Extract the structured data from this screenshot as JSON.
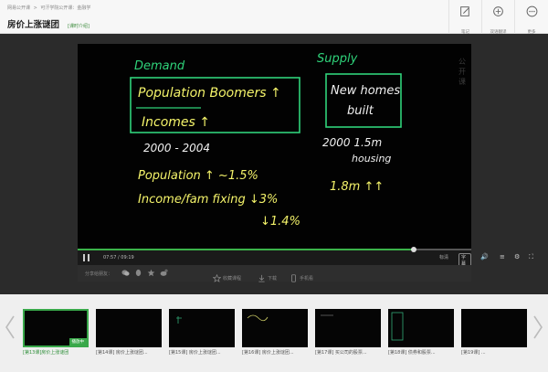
{
  "header": {
    "breadcrumb": [
      "网易公开课",
      ">",
      "可汗学院公开课：金融学"
    ],
    "title": "房价上涨谜团",
    "tag": "[课时介绍]",
    "buttons": [
      {
        "label": "笔记",
        "icon": "edit-icon"
      },
      {
        "label": "双语翻译",
        "icon": "translate-icon"
      },
      {
        "label": "更多",
        "icon": "more-icon"
      }
    ]
  },
  "video": {
    "watermark": "公开课",
    "board": {
      "demand_title": "Demand",
      "demand_line1": "Population Boomers ↑",
      "demand_line2": "Incomes ↑",
      "supply_title": "Supply",
      "supply_line1": "New homes",
      "supply_line2": "built",
      "years_left": "2000 - 2004",
      "years_right": "2000  1.5m",
      "housing": "housing",
      "pop_line": "Population ↑ ~1.5%",
      "income_line": "Income/fam fixing ↓3%",
      "income_line2": "↓1.4%",
      "supply_value": "1.8m ↑↑"
    },
    "colors": {
      "chalk_green": "#2fd37a",
      "chalk_yellow": "#f4f36a",
      "chalk_white": "#f0f0f0"
    }
  },
  "controls": {
    "time": "07:57 / 09:19",
    "progress": 0.853,
    "hd_label": "标清",
    "subtitle_label": "字幕",
    "volume_icon": "volume-icon"
  },
  "actions": {
    "share_label": "分享给朋友：",
    "share_icons": [
      "wechat-icon",
      "qq-icon",
      "star-icon",
      "weibo-icon"
    ],
    "items": [
      {
        "label": "收藏课程",
        "icon": "star-icon"
      },
      {
        "label": "下载",
        "icon": "download-icon"
      },
      {
        "label": "手机看",
        "icon": "mobile-icon"
      }
    ]
  },
  "playlist": {
    "playing_badge": "播放中",
    "items": [
      {
        "caption": "[第13课]房价上涨谜团"
      },
      {
        "caption": "[第14课] 房价上涨谜团..."
      },
      {
        "caption": "[第15课] 房价上涨谜团..."
      },
      {
        "caption": "[第16课] 房价上涨谜团..."
      },
      {
        "caption": "[第17课] 买公司的股票..."
      },
      {
        "caption": "[第18课] 债券和股票..."
      },
      {
        "caption": "[第19课] ..."
      }
    ]
  },
  "brand": {
    "text": "什么值得买"
  }
}
